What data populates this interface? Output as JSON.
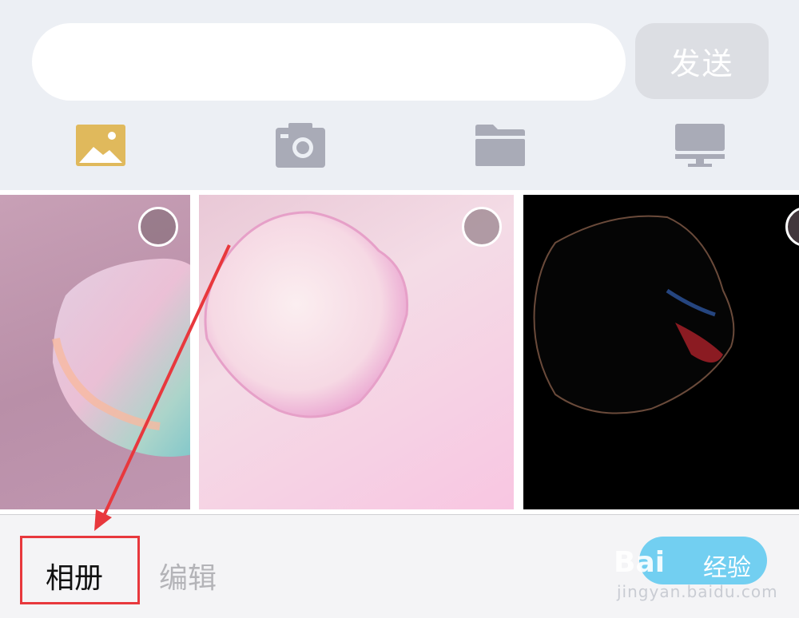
{
  "input": {
    "placeholder": "",
    "value": ""
  },
  "send_button": {
    "label": "发送"
  },
  "toolbar": [
    {
      "icon": "image-icon",
      "color": "#e0b95c"
    },
    {
      "icon": "camera-icon",
      "color": "#a9abb7"
    },
    {
      "icon": "folder-icon",
      "color": "#a9abb7"
    },
    {
      "icon": "monitor-icon",
      "color": "#a9abb7"
    }
  ],
  "photos": [
    {
      "name": "photo-1",
      "selected": false
    },
    {
      "name": "photo-2",
      "selected": false
    },
    {
      "name": "photo-3",
      "selected": false
    }
  ],
  "bottom_tabs": {
    "album": "相册",
    "edit": "编辑"
  },
  "annotation": {
    "highlight_color": "#e8383d"
  },
  "watermark": {
    "brand": "Bai",
    "brand_cn": "经验",
    "url": "jingyan.baidu.com"
  }
}
